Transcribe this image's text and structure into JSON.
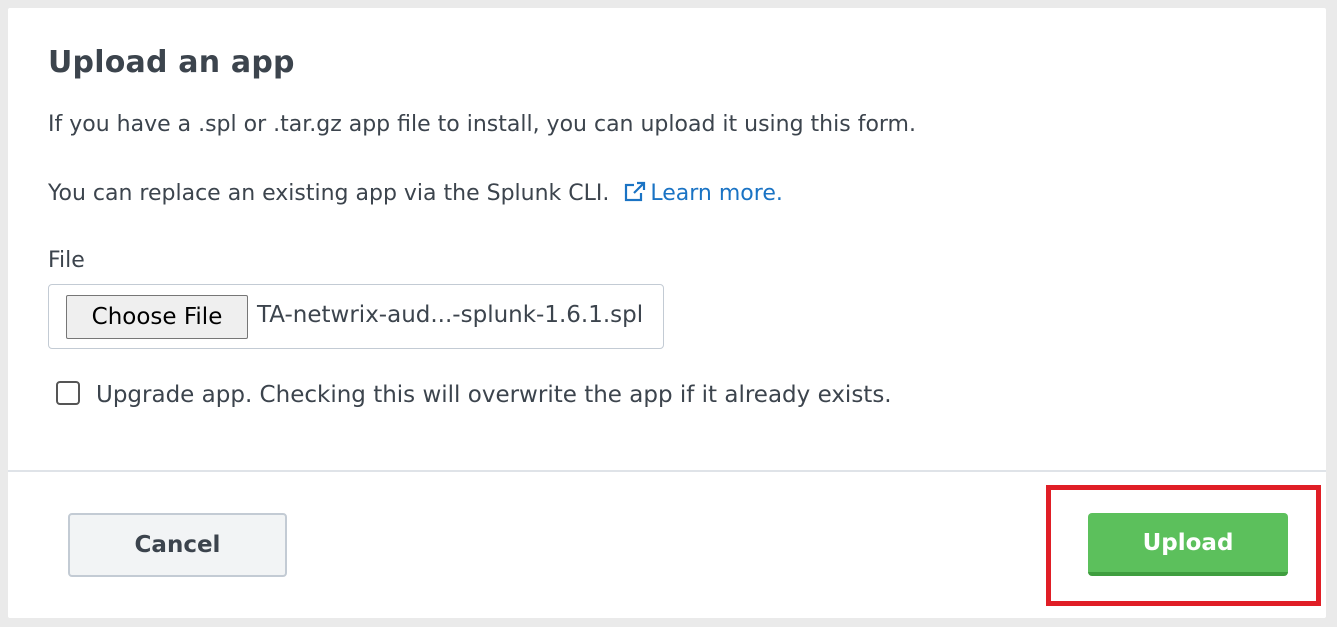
{
  "dialog": {
    "title": "Upload an app",
    "description_1": "If you have a .spl or .tar.gz app file to install, you can upload it using this form.",
    "description_2": "You can replace an existing app via the Splunk CLI.",
    "learn_more_label": "Learn more.",
    "learn_more_icon": "external-link-icon"
  },
  "file_field": {
    "label": "File",
    "choose_button_label": "Choose File",
    "selected_file": "TA-netwrix-aud...-splunk-1.6.1.spl"
  },
  "upgrade_checkbox": {
    "label": "Upgrade app. Checking this will overwrite the app if it already exists.",
    "checked": false
  },
  "footer": {
    "cancel_label": "Cancel",
    "upload_label": "Upload"
  },
  "colors": {
    "link": "#1a73c4",
    "upload_green": "#5cc05c",
    "highlight_red": "#e01e26"
  }
}
